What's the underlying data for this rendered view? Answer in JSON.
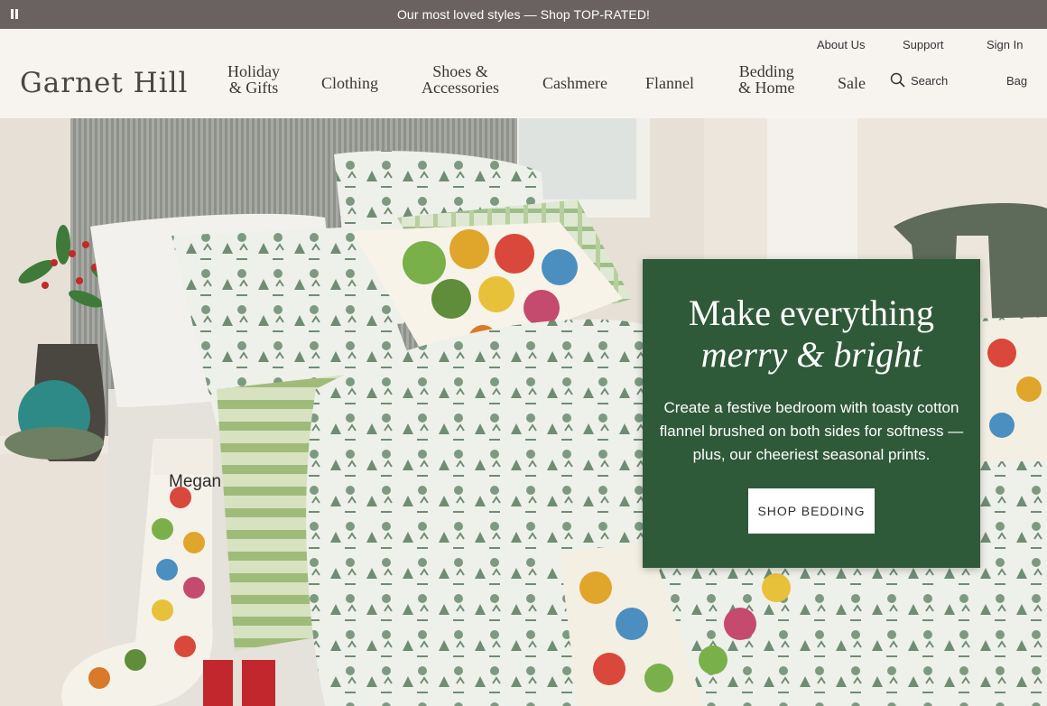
{
  "promo": {
    "message": "Our most loved styles — Shop TOP-RATED!"
  },
  "utility": {
    "about": "About Us",
    "support": "Support",
    "signin": "Sign In"
  },
  "brand": {
    "logo": "Garnet Hill"
  },
  "nav": {
    "holiday_1": "Holiday",
    "holiday_2": "& Gifts",
    "clothing": "Clothing",
    "shoes_1": "Shoes &",
    "shoes_2": "Accessories",
    "cashmere": "Cashmere",
    "flannel": "Flannel",
    "bedding_1": "Bedding",
    "bedding_2": "& Home",
    "sale": "Sale",
    "search": "Search",
    "bag": "Bag"
  },
  "hero": {
    "headline": "Make everything",
    "headline_italic": "merry & bright",
    "body": "Create a festive bedroom with toasty cotton flannel brushed on both sides for softness — plus, our cheeriest seasonal prints.",
    "cta": "SHOP BEDDING",
    "stocking_name": "Megan"
  },
  "colors": {
    "card_green": "#2f5a3a",
    "promo_bar": "#6a6260",
    "header_bg": "#f7f4f0"
  }
}
